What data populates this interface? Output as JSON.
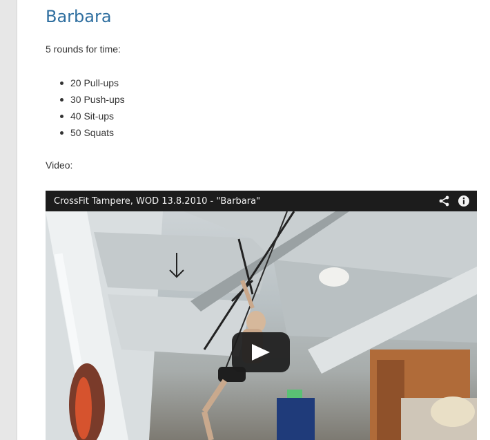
{
  "article": {
    "title": "Barbara",
    "intro": "5 rounds for time:",
    "movements": [
      "20 Pull-ups",
      "30 Push-ups",
      "40 Sit-ups",
      "50 Squats"
    ],
    "video_label": "Video:"
  },
  "video": {
    "title": "CrossFit Tampere, WOD 13.8.2010 - \"Barbara\"",
    "icons": [
      "share-icon",
      "info-icon",
      "play-icon"
    ]
  },
  "colors": {
    "title": "#2f6fa0",
    "text": "#333333",
    "rail": "#e7e7e7",
    "video_bar": "#1c1c1c"
  }
}
